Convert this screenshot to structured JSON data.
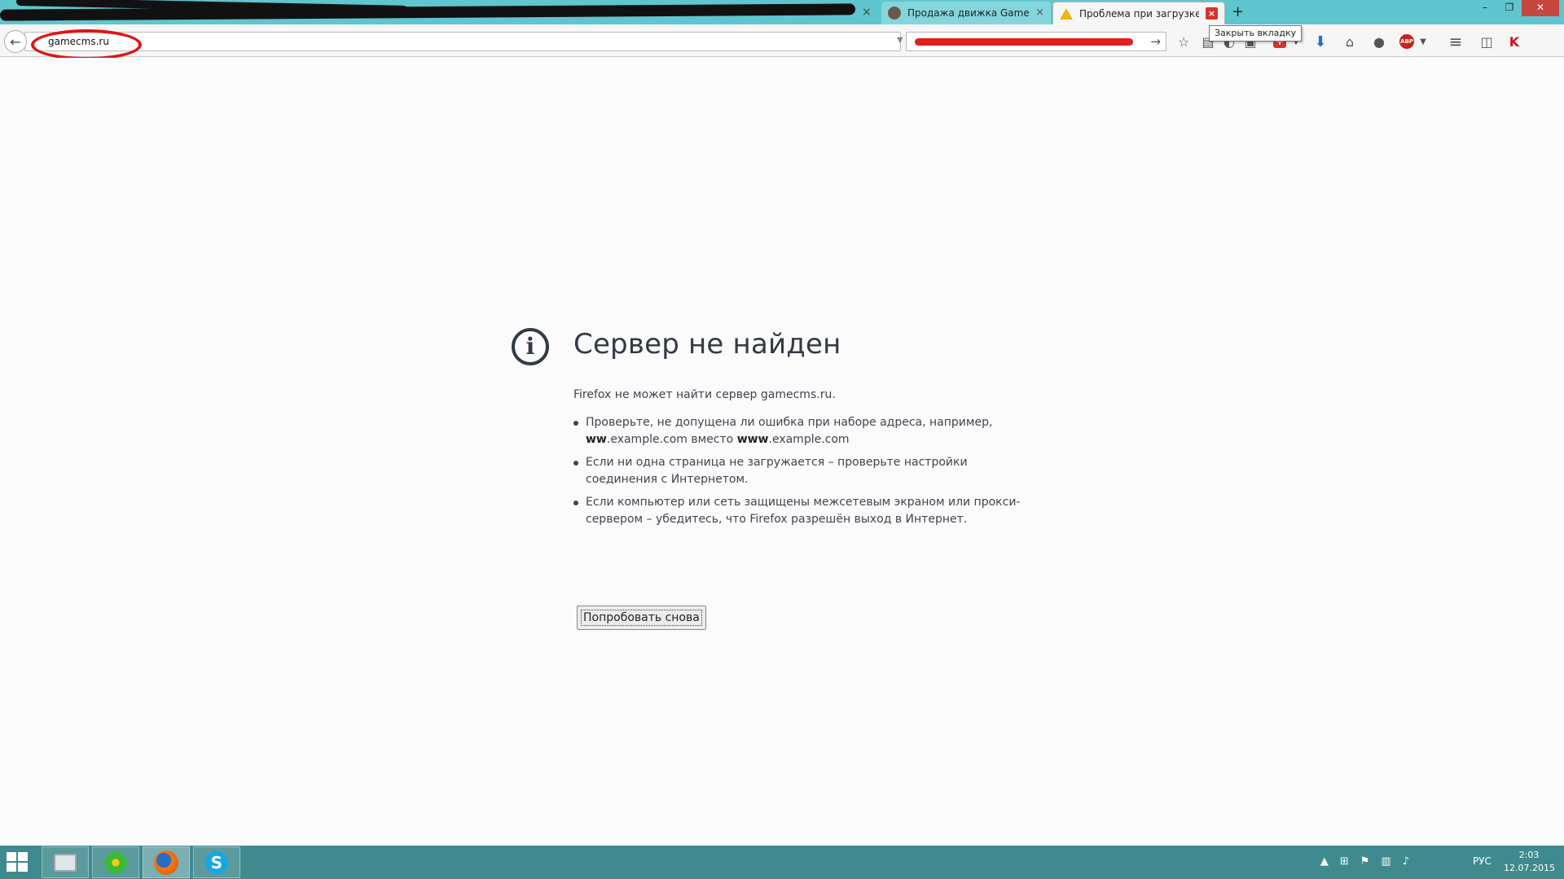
{
  "tabs": {
    "inactive_title": "Продажа движка GameC...",
    "active_title": "Проблема при загрузке с...",
    "close_symbol": "×",
    "new_tab_symbol": "+"
  },
  "window": {
    "minimize": "–",
    "restore": "❐",
    "close": "✕"
  },
  "navbar": {
    "back_symbol": "←",
    "url": "gamecms.ru",
    "dropdown_symbol": "▼",
    "reload_symbol": "↻",
    "search_go_symbol": "→",
    "tooltip": "Закрыть вкладку"
  },
  "toolbar_icons": [
    "star-icon",
    "reading-list-icon",
    "pocket-icon",
    "screenshot-icon",
    "red-cross-icon",
    "chevron-down-icon",
    "download-icon",
    "home-icon",
    "chat-icon",
    "adblock-icon",
    "menu-icon",
    "sidebar-icon",
    "kaspersky-icon"
  ],
  "toolbar_text": {
    "abp": "ABP",
    "kasp": "K",
    "menu": "≡"
  },
  "error": {
    "title": "Сервер не найден",
    "description": "Firefox не может найти сервер gamecms.ru.",
    "items": [
      {
        "pre_bold": "ww",
        "line1": "Проверьте, не допущена ли ошибка при наборе адреса, например,",
        "line2_a": ".example.com вместо ",
        "bold2": "www",
        "line2_b": ".example.com"
      },
      {
        "text": "Если ни одна страница не загружается – проверьте настройки соединения с Интернетом."
      },
      {
        "text": "Если компьютер или сеть защищены межсетевым экраном или прокси-сервером – убедитесь, что Firefox разрешён выход в Интернет."
      }
    ],
    "retry_label": "Попробовать снова"
  },
  "taskbar": {
    "apps": [
      "monitor-app",
      "icq-app",
      "firefox-app",
      "skype-app"
    ],
    "skype_letter": "S",
    "lang": "РУС",
    "time": "2:03",
    "date": "12.07.2015"
  },
  "colors": {
    "tabstrip": "#5fc5cf",
    "taskbar": "#3f8a8e",
    "annotation_red": "#e01515"
  }
}
